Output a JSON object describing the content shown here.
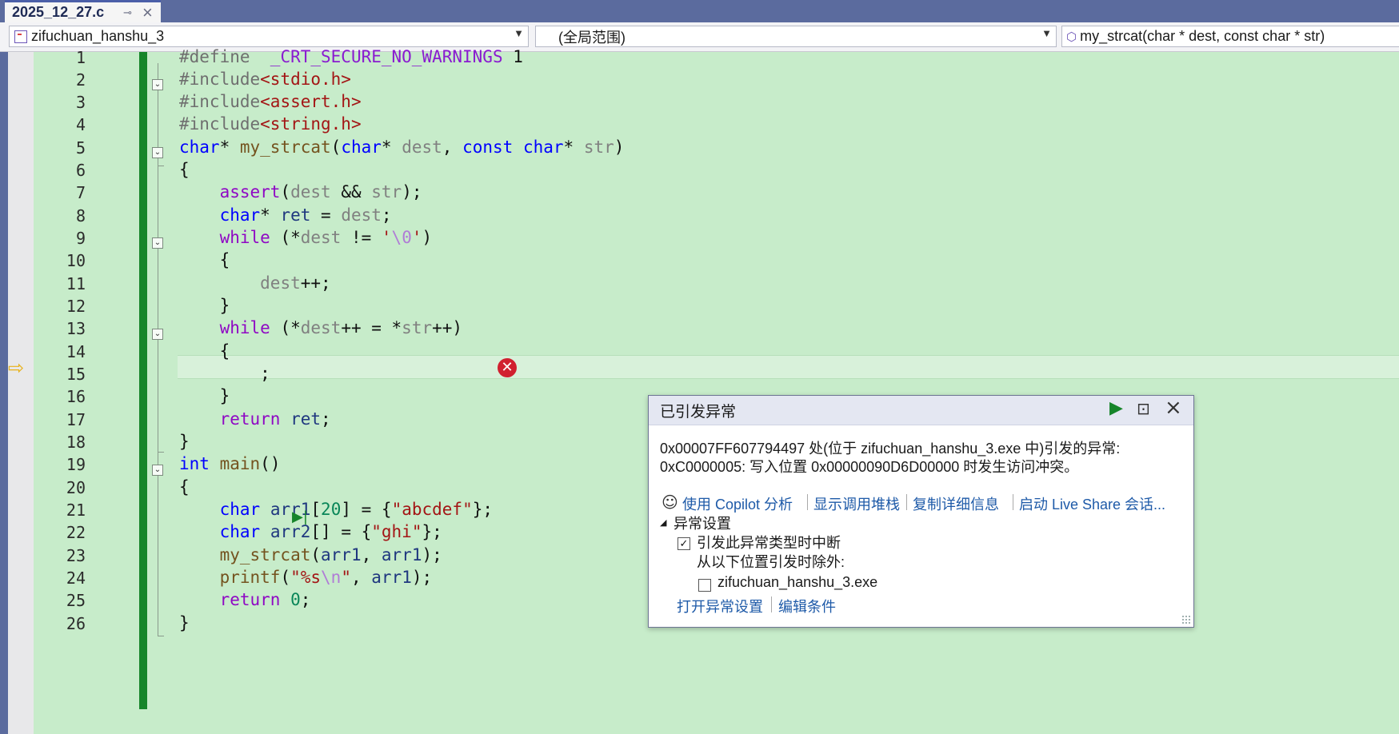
{
  "tab": {
    "filename": "2025_12_27.c",
    "pin_glyph": "⊸",
    "close_glyph": "×"
  },
  "nav": {
    "project": "zifuchuan_hanshu_3",
    "scope": "(全局范围)",
    "member": "my_strcat(char * dest, const char * str)",
    "member_icon": "cube-icon"
  },
  "editor": {
    "line_numbers": [
      "1",
      "2",
      "3",
      "4",
      "5",
      "6",
      "7",
      "8",
      "9",
      "10",
      "11",
      "12",
      "13",
      "14",
      "15",
      "16",
      "17",
      "18",
      "19",
      "20",
      "21",
      "22",
      "23",
      "24",
      "25",
      "26"
    ],
    "current_line": "13",
    "colors": {
      "keyword": "#0000ff",
      "string": "#a31515",
      "macro": "#8a1bd0",
      "control": "#8f08c4",
      "change_bar": "#16852a",
      "background": "#c7ecca"
    }
  },
  "code": {
    "l1": {
      "a": "#define  ",
      "b": "_CRT_SECURE_NO_WARNINGS",
      "c": " 1"
    },
    "l2": {
      "a": "#include",
      "b": "<stdio.h>"
    },
    "l3": {
      "a": "#include",
      "b": "<assert.h>"
    },
    "l4": {
      "a": "#include",
      "b": "<string.h>"
    },
    "l5": {
      "a": "char",
      "b": "* ",
      "c": "my_strcat",
      "d": "(",
      "e": "char",
      "f": "* ",
      "g": "dest",
      "h": ", ",
      "i": "const",
      "j": " ",
      "k": "char",
      "l": "* ",
      "m": "str",
      "n": ")"
    },
    "l6": {
      "a": "{"
    },
    "l7": {
      "a": "    ",
      "b": "assert",
      "c": "(",
      "d": "dest",
      "e": " && ",
      "f": "str",
      "g": ");"
    },
    "l8": {
      "a": "    ",
      "b": "char",
      "c": "* ",
      "d": "ret",
      "e": " = ",
      "f": "dest",
      "g": ";"
    },
    "l9": {
      "a": "    ",
      "b": "while",
      "c": " (*",
      "d": "dest",
      "e": " != ",
      "f": "'",
      "g": "\\0",
      "h": "'",
      "i": ")"
    },
    "l10": {
      "a": "    {"
    },
    "l11": {
      "a": "        ",
      "b": "dest",
      "c": "++;"
    },
    "l12": {
      "a": "    }"
    },
    "l13": {
      "a": "    ",
      "b": "while",
      "c": " (*",
      "d": "dest",
      "e": "++ = *",
      "f": "str",
      "g": "++)"
    },
    "l14": {
      "a": "    {"
    },
    "l15": {
      "a": "        ;"
    },
    "l16": {
      "a": "    }"
    },
    "l17": {
      "a": "    ",
      "b": "return",
      "c": " ",
      "d": "ret",
      "e": ";"
    },
    "l18": {
      "a": "}"
    },
    "l19": {
      "a": "int",
      "b": " ",
      "c": "main",
      "d": "()"
    },
    "l20": {
      "a": "{"
    },
    "l21": {
      "a": "    ",
      "b": "char",
      "c": " ",
      "d": "arr1",
      "e": "[",
      "f": "20",
      "g": "] = {",
      "h": "\"abcdef\"",
      "i": "};"
    },
    "l22": {
      "a": "    ",
      "b": "char",
      "c": " ",
      "d": "arr2",
      "e": "[] = {",
      "f": "\"ghi\"",
      "g": "};"
    },
    "l23": {
      "a": "    ",
      "b": "my_strcat",
      "c": "(",
      "d": "arr1",
      "e": ", ",
      "f": "arr1",
      "g": ");"
    },
    "l24": {
      "a": "    ",
      "b": "printf",
      "c": "(",
      "d": "\"%s",
      "e": "\\n",
      "f": "\"",
      "g": ", ",
      "h": "arr1",
      "i": ");"
    },
    "l25": {
      "a": "    ",
      "b": "return",
      "c": " ",
      "d": "0",
      "e": ";"
    },
    "l26": {
      "a": "}"
    }
  },
  "exception": {
    "title": "已引发异常",
    "message_line1": "0x00007FF607794497 处(位于 zifuchuan_hanshu_3.exe 中)引发的异常:",
    "message_line2": "0xC0000005: 写入位置 0x00000090D6D00000 时发生访问冲突。",
    "links": [
      "使用 Copilot 分析",
      "显示调用堆栈",
      "复制详细信息",
      "启动 Live Share 会话..."
    ],
    "settings_header": "异常设置",
    "break_when_thrown": "引发此异常类型时中断",
    "except_from": "从以下位置引发时除外:",
    "module": "zifuchuan_hanshu_3.exe",
    "bottom_links": [
      "打开异常设置",
      "编辑条件"
    ],
    "break_checked": true,
    "module_checked": false
  }
}
